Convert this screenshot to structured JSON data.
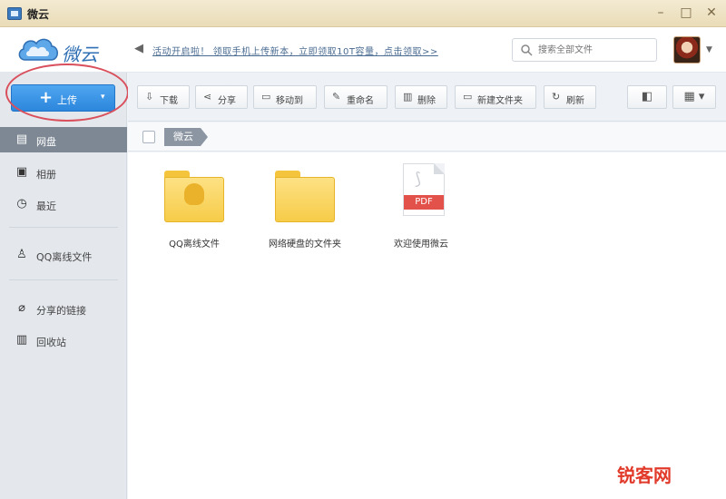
{
  "window": {
    "title": "微云",
    "min": "–",
    "max": "□",
    "close": "✕"
  },
  "header": {
    "logo_text": "微云",
    "notice": "活动开启啦！ 领取手机上传新本，立即领取10T容量，点击领取>>",
    "search": {
      "placeholder": "搜索全部文件"
    }
  },
  "sidebar": {
    "upload": {
      "label": "上传",
      "plus": "+",
      "caret": "▾"
    },
    "items": [
      {
        "label": "网盘",
        "icon": "hard-drive-icon",
        "glyph": "▤",
        "active": true
      },
      {
        "label": "相册",
        "icon": "photo-album-icon",
        "glyph": "▣"
      },
      {
        "label": "最近",
        "icon": "clock-icon",
        "glyph": "◷"
      },
      {
        "label": "QQ离线文件",
        "icon": "qq-penguin-icon",
        "glyph": "♙"
      },
      {
        "label": "分享的链接",
        "icon": "link-icon",
        "glyph": "⌀"
      },
      {
        "label": "回收站",
        "icon": "trash-icon",
        "glyph": "▥"
      }
    ]
  },
  "toolbar": {
    "buttons": [
      {
        "label": "下载",
        "glyph": "⇩"
      },
      {
        "label": "分享",
        "glyph": "⋖"
      },
      {
        "label": "移动到",
        "glyph": "▭"
      },
      {
        "label": "重命名",
        "glyph": "✎"
      },
      {
        "label": "删除",
        "glyph": "▥"
      },
      {
        "label": "新建文件夹",
        "glyph": "▭"
      },
      {
        "label": "刷新",
        "glyph": "↻"
      }
    ],
    "view_detail": "◧",
    "view_grid": "▦ ▾"
  },
  "breadcrumb": {
    "current": "微云"
  },
  "files": [
    {
      "name": "QQ离线文件",
      "type": "folder",
      "badge": true
    },
    {
      "name": "网络硬盘的文件夹",
      "type": "folder",
      "badge": false
    },
    {
      "name": "欢迎使用微云",
      "type": "pdf",
      "band": "PDF"
    }
  ],
  "colors": {
    "accent": "#2c86dc",
    "sidebar_active": "#7e8894",
    "highlight": "#d94f5c"
  },
  "watermark": "锐客网"
}
